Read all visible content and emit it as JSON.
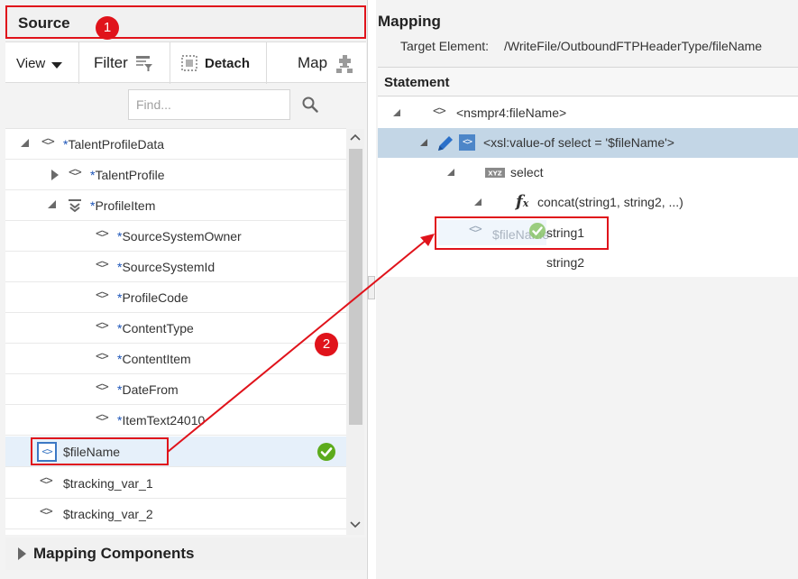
{
  "source": {
    "title": "Source",
    "badge": "1"
  },
  "toolbar": {
    "view_label": "View",
    "filter_label": "Filter",
    "detach_label": "Detach",
    "map_label": "Map"
  },
  "find": {
    "placeholder": "Find..."
  },
  "tree": [
    {
      "prefix": "*",
      "label": "TalentProfileData"
    },
    {
      "prefix": "*",
      "label": "TalentProfile"
    },
    {
      "prefix": "*",
      "label": "ProfileItem"
    },
    {
      "prefix": "*",
      "label": "SourceSystemOwner"
    },
    {
      "prefix": "*",
      "label": "SourceSystemId"
    },
    {
      "prefix": "*",
      "label": "ProfileCode"
    },
    {
      "prefix": "*",
      "label": "ContentType"
    },
    {
      "prefix": "*",
      "label": "ContentItem"
    },
    {
      "prefix": "*",
      "label": "DateFrom"
    },
    {
      "prefix": "*",
      "label": "ItemText24010"
    },
    {
      "prefix": "",
      "label": "$fileName"
    },
    {
      "prefix": "",
      "label": "$tracking_var_1"
    },
    {
      "prefix": "",
      "label": "$tracking_var_2"
    }
  ],
  "mapping_components": {
    "label": "Mapping Components"
  },
  "mapping": {
    "title": "Mapping",
    "target_label": "Target Element:",
    "target_value": "/WriteFile/OutboundFTPHeaderType/fileName"
  },
  "statement": {
    "title": "Statement",
    "rows": [
      {
        "label": "<nsmpr4:fileName>"
      },
      {
        "label": "<xsl:value-of select = '$fileName'>"
      },
      {
        "label": "select"
      },
      {
        "label": "concat(string1, string2, ...)"
      },
      {
        "label": "string1"
      },
      {
        "label": "string2"
      }
    ],
    "drag_ghost": "$fileName"
  },
  "annotations": {
    "badge_2": "2"
  },
  "colors": {
    "highlight": "#e0131b",
    "accent": "#1a53b8",
    "success": "#5cab1c",
    "selected_row": "#c3d6e6"
  }
}
